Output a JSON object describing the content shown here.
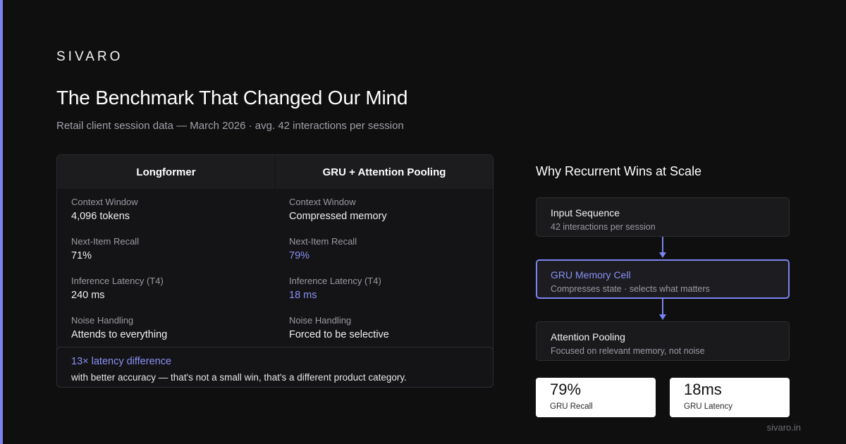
{
  "brand": "SIVARO",
  "title": "The Benchmark That Changed Our Mind",
  "subtitle": "Retail client session data — March 2026 · avg. 42 interactions per session",
  "comparison": {
    "columns": [
      "Longformer",
      "GRU + Attention Pooling"
    ],
    "rows": [
      {
        "label": "Context Window",
        "values": [
          "4,096 tokens",
          "Compressed memory"
        ]
      },
      {
        "label": "Next-Item Recall",
        "values": [
          "71%",
          "79%"
        ]
      },
      {
        "label": "Inference Latency (T4)",
        "values": [
          "240 ms",
          "18 ms"
        ]
      },
      {
        "label": "Noise Handling",
        "values": [
          "Attends to everything",
          "Forced to be selective"
        ]
      }
    ],
    "callout": {
      "headline": "13× latency difference",
      "body": "with better accuracy — that's not a small win, that's a different product category."
    }
  },
  "flow": {
    "title": "Why Recurrent Wins at Scale",
    "nodes": [
      {
        "title": "Input Sequence",
        "subtitle": "42 interactions per session"
      },
      {
        "title": "GRU Memory Cell",
        "subtitle": "Compresses state · selects what matters"
      },
      {
        "title": "Attention Pooling",
        "subtitle": "Focused on relevant memory, not noise"
      }
    ]
  },
  "stats": [
    {
      "value": "79%",
      "label": "GRU Recall"
    },
    {
      "value": "18ms",
      "label": "GRU Latency"
    }
  ],
  "footer": "sivaro.in",
  "colors": {
    "accent": "#7b83f0",
    "highlight": "#8a90f5",
    "background": "#0f0f10"
  }
}
